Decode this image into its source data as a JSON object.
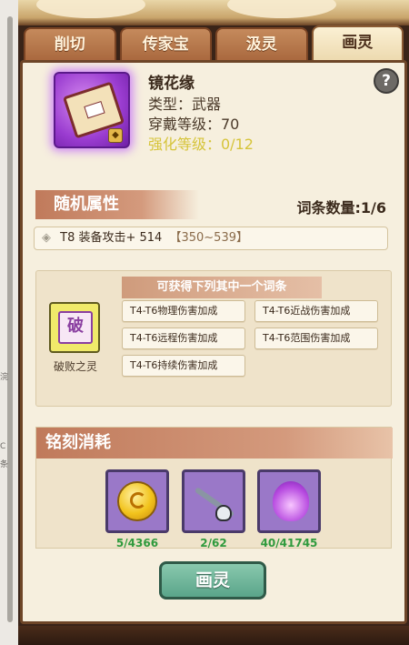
{
  "tabs": [
    "削切",
    "传家宝",
    "汲灵",
    "画灵"
  ],
  "active_tab_index": 3,
  "item": {
    "name": "镜花缘",
    "type_line": "类型：武器",
    "equip_level_line": "穿戴等级：70",
    "enhance_line": "强化等级：0/12",
    "rarity_color": "#9a3cd0",
    "locked": true,
    "icon": "book-icon"
  },
  "help_label": "?",
  "random_attrs": {
    "title": "随机属性",
    "entry_count": "词条数量:1/6",
    "rows": [
      {
        "text": "T8 装备攻击+ 514",
        "range": "【350~539】"
      }
    ]
  },
  "choice": {
    "header": "可获得下列其中一个词条",
    "spirit_name": "破败之灵",
    "spirit_glyph": "破",
    "options": [
      "T4-T6物理伤害加成",
      "T4-T6近战伤害加成",
      "T4-T6远程伤害加成",
      "T4-T6范围伤害加成",
      "T4-T6持续伤害加成"
    ]
  },
  "cost": {
    "title": "铭刻消耗",
    "items": [
      {
        "icon": "gold-coin-icon",
        "qty": "5/4366"
      },
      {
        "icon": "brush-icon",
        "qty": "2/62"
      },
      {
        "icon": "purple-spirit-flame-icon",
        "qty": "40/41745"
      }
    ],
    "qty_color": "#2f9a3d"
  },
  "action_button": "画灵",
  "left_strip": {
    "c1": "浣",
    "c2": "C",
    "c3": "条"
  }
}
